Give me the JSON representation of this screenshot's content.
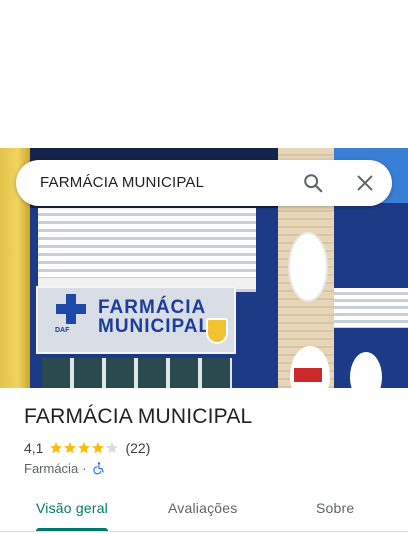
{
  "search": {
    "query": "FARMÁCIA MUNICIPAL"
  },
  "photo": {
    "sign_text": "FARMÁCIA MUNICIPAL",
    "sign_small": "DAF"
  },
  "place": {
    "name": "FARMÁCIA MUNICIPAL",
    "rating": "4,1",
    "stars": 4.1,
    "reviews": "(22)",
    "category": "Farmácia",
    "separator": "·"
  },
  "tabs": [
    {
      "label": "Visão geral",
      "active": true
    },
    {
      "label": "Avaliações",
      "active": false
    },
    {
      "label": "Sobre",
      "active": false
    }
  ],
  "colors": {
    "accent": "#00796b",
    "star": "#fbbc04",
    "star_empty": "#dadce0",
    "accessibility": "#1a73e8"
  },
  "icons": {
    "search": "search-icon",
    "close": "close-icon",
    "accessibility": "wheelchair-icon"
  }
}
